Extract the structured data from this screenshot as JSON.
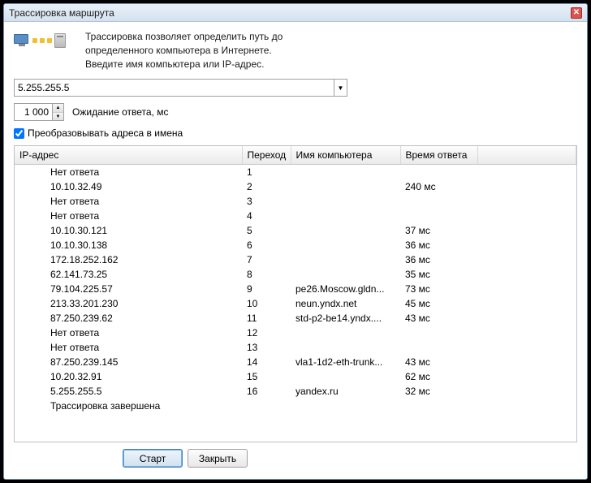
{
  "title": "Трассировка маршрута",
  "description": {
    "line1": "Трассировка позволяет определить путь до",
    "line2": "определенного компьютера в Интернете.",
    "line3": "Введите имя компьютера или IP-адрес."
  },
  "ip_value": "5.255.255.5",
  "timeout_value": "1 000",
  "timeout_label": "Ожидание ответа, мс",
  "resolve_label": "Преобразовывать адреса в имена",
  "columns": {
    "ip": "IP-адрес",
    "hop": "Переход",
    "host": "Имя компьютера",
    "rtt": "Время ответа"
  },
  "rows": [
    {
      "ip": "Нет ответа",
      "hop": "1",
      "host": "",
      "rtt": ""
    },
    {
      "ip": "10.10.32.49",
      "hop": "2",
      "host": "",
      "rtt": "240 мс"
    },
    {
      "ip": "Нет ответа",
      "hop": "3",
      "host": "",
      "rtt": ""
    },
    {
      "ip": "Нет ответа",
      "hop": "4",
      "host": "",
      "rtt": ""
    },
    {
      "ip": "10.10.30.121",
      "hop": "5",
      "host": "",
      "rtt": "37 мс"
    },
    {
      "ip": "10.10.30.138",
      "hop": "6",
      "host": "",
      "rtt": "36 мс"
    },
    {
      "ip": "172.18.252.162",
      "hop": "7",
      "host": "",
      "rtt": "36 мс"
    },
    {
      "ip": "62.141.73.25",
      "hop": "8",
      "host": "",
      "rtt": "35 мс"
    },
    {
      "ip": "79.104.225.57",
      "hop": "9",
      "host": "pe26.Moscow.gldn...",
      "rtt": "73 мс"
    },
    {
      "ip": "213.33.201.230",
      "hop": "10",
      "host": "neun.yndx.net",
      "rtt": "45 мс"
    },
    {
      "ip": "87.250.239.62",
      "hop": "11",
      "host": "std-p2-be14.yndx....",
      "rtt": "43 мс"
    },
    {
      "ip": "Нет ответа",
      "hop": "12",
      "host": "",
      "rtt": ""
    },
    {
      "ip": "Нет ответа",
      "hop": "13",
      "host": "",
      "rtt": ""
    },
    {
      "ip": "87.250.239.145",
      "hop": "14",
      "host": "vla1-1d2-eth-trunk...",
      "rtt": "43 мс"
    },
    {
      "ip": "10.20.32.91",
      "hop": "15",
      "host": "",
      "rtt": "62 мс"
    },
    {
      "ip": "5.255.255.5",
      "hop": "16",
      "host": "yandex.ru",
      "rtt": "32 мс"
    },
    {
      "ip": "Трассировка завершена",
      "hop": "",
      "host": "",
      "rtt": ""
    }
  ],
  "buttons": {
    "start": "Старт",
    "close": "Закрыть"
  }
}
